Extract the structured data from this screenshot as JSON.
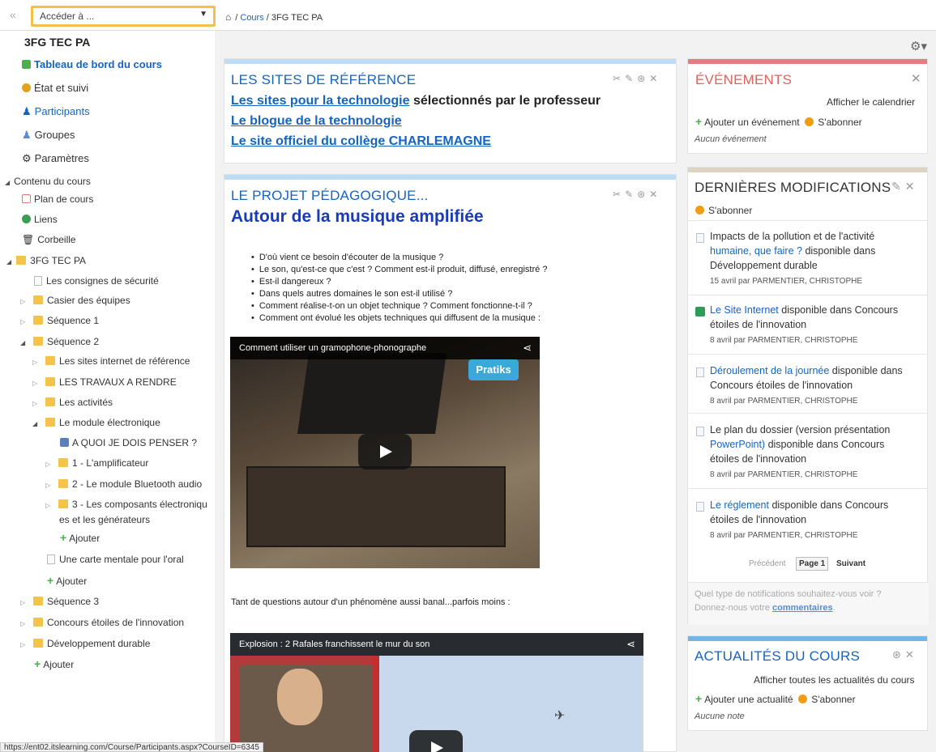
{
  "topbar": {
    "goto_placeholder": "Accéder à ...",
    "breadcrumb_cours": "Cours",
    "breadcrumb_sep": "/",
    "breadcrumb_current": "3FG TEC PA"
  },
  "sidebar": {
    "course_title": "3FG TEC PA",
    "dashboard": "Tableau de bord du cours",
    "etat": "État et suivi",
    "participants": "Participants",
    "groupes": "Groupes",
    "parametres": "Paramètres",
    "contenu": "Contenu du cours",
    "plan": "Plan de cours",
    "liens": "Liens",
    "corbeille": "Corbeille",
    "root": "3FG TEC PA",
    "consignes": "Les consignes de sécurité",
    "casier": "Casier des équipes",
    "seq1": "Séquence 1",
    "seq2": "Séquence 2",
    "sites": "Les sites internet de référence",
    "travaux": "LES TRAVAUX A RENDRE",
    "activites": "Les activités",
    "module": "Le module électronique",
    "penser": "A QUOI JE DOIS PENSER ?",
    "ampli": "1 - L'amplificateur",
    "bluetooth": "2 - Le module Bluetooth audio",
    "composants_1": "3 - Les composants électroniqu",
    "composants_2": "es et les générateurs",
    "ajouter1": "Ajouter",
    "carte": "Une carte mentale pour l'oral",
    "ajouter2": "Ajouter",
    "seq3": "Séquence 3",
    "concours": "Concours étoiles de l'innovation",
    "dev": "Développement durable",
    "ajouter3": "Ajouter"
  },
  "sites_panel": {
    "title": "LES SITES DE RÉFÉRENCE",
    "link1": "Les sites pour la technologie",
    "link1_rest": " sélectionnés par le professeur",
    "link2": "Le blogue de la technologie",
    "link3": "Le site officiel du collège CHARLEMAGNE"
  },
  "projet_panel": {
    "title": "LE PROJET PÉDAGOGIQUE...",
    "heading": "Autour de la musique amplifiée",
    "questions": [
      "D'où vient ce besoin d'écouter de la musique ?",
      "Le son, qu'est-ce que c'est ? Comment est-il produit, diffusé, enregistré ?",
      "Est-il dangereux ?",
      "Dans quels autres domaines le son est-il utilisé ?",
      "Comment réalise-t-on un objet technique ? Comment fonctionne-t-il ?",
      "Comment ont évolué les objets techniques qui diffusent de la musique :"
    ],
    "video1_title": "Comment utiliser un gramophone-phonographe",
    "video1_brand": "Pratiks",
    "middle_text": "Tant de questions autour d'un phénomène aussi banal...parfois moins :",
    "video2_title": "Explosion : 2 Rafales franchissent le mur du son"
  },
  "events": {
    "title": "ÉVÉNEMENTS",
    "calendar": "Afficher le calendrier",
    "add": "Ajouter un événement",
    "subscribe": "S'abonner",
    "empty": "Aucun événement"
  },
  "changes": {
    "title": "DERNIÈRES MODIFICATIONS",
    "subscribe": "S'abonner",
    "items": [
      {
        "link": "Impacts de la pollution et de l'activité",
        "link2": "humaine, que faire ?",
        "rest": " disponible dans",
        "place": "Développement durable",
        "meta": "15 avril par PARMENTIER, CHRISTOPHE"
      },
      {
        "link": "Le Site Internet",
        "rest": " disponible dans Concours",
        "place": "étoiles de l'innovation",
        "meta": "8 avril par PARMENTIER, CHRISTOPHE"
      },
      {
        "link": "Déroulement de la journée",
        "rest": " disponible dans",
        "place": "Concours étoiles de l'innovation",
        "meta": "8 avril par PARMENTIER, CHRISTOPHE"
      },
      {
        "link": "Le plan du dossier (version présentation",
        "link2": "PowerPoint)",
        "rest": " disponible dans Concours",
        "place": "étoiles de l'innovation",
        "meta": "8 avril par PARMENTIER, CHRISTOPHE"
      },
      {
        "link": "Le réglement",
        "rest": " disponible dans Concours",
        "place": "étoiles de l'innovation",
        "meta": "8 avril par PARMENTIER, CHRISTOPHE"
      }
    ],
    "prev": "Précédent",
    "page": "Page 1",
    "next": "Suivant",
    "feedback1": "Quel type de notifications souhaitez-vous voir ?",
    "feedback2": "Donnez-nous votre ",
    "feedback_link": "commentaires",
    "feedback_end": "."
  },
  "news": {
    "title": "ACTUALITÉS DU COURS",
    "all": "Afficher toutes les actualités du cours",
    "add": "Ajouter une actualité",
    "subscribe": "S'abonner",
    "empty": "Aucune note"
  },
  "status_url": "https://ent02.itslearning.com/Course/Participants.aspx?CourseID=6345",
  "colors": {
    "accent": "#1565c0",
    "goto_border": "#f5c04a",
    "events_bar": "#e77b82",
    "panel_bar": "#bfdcf5"
  }
}
